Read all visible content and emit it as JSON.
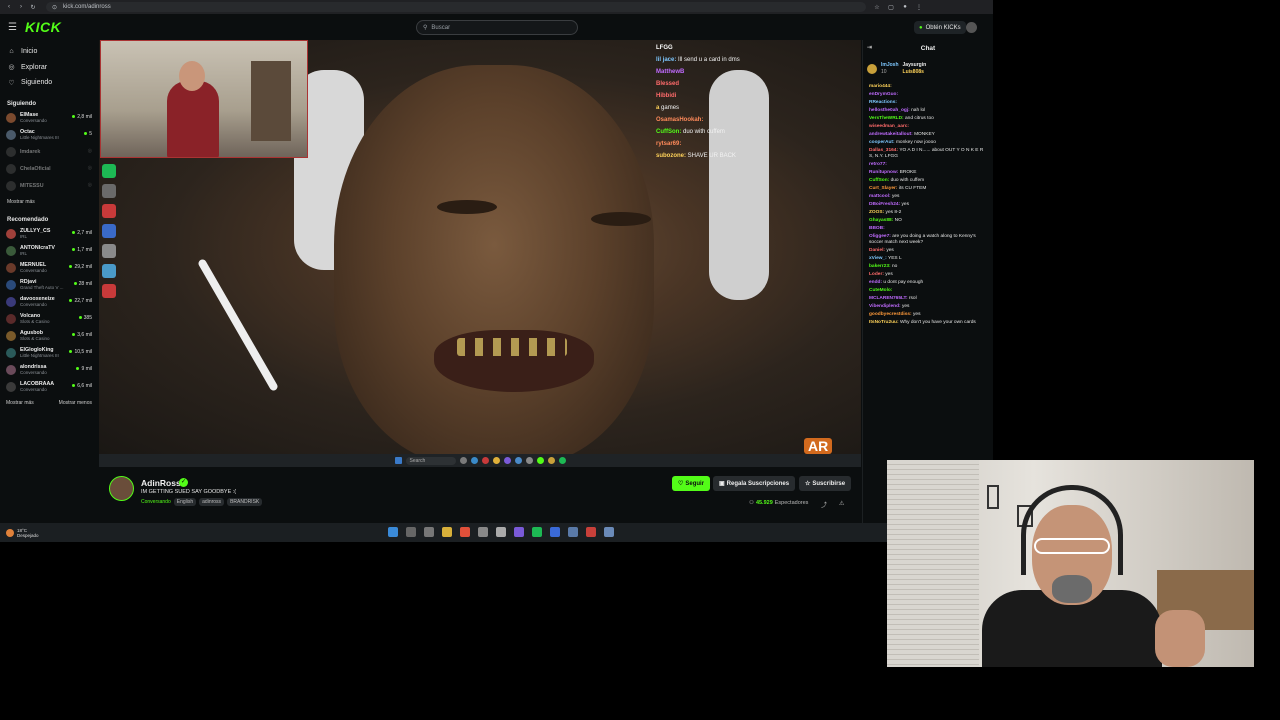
{
  "browser": {
    "url": "kick.com/adinross"
  },
  "header": {
    "logo": "KICK",
    "search_placeholder": "Buscar",
    "obtain_kicks": "Obtén KICKs"
  },
  "sidebar": {
    "nav": [
      {
        "label": "Inicio",
        "icon": "home-icon"
      },
      {
        "label": "Explorar",
        "icon": "compass-icon"
      },
      {
        "label": "Siguiendo",
        "icon": "heart-icon"
      }
    ],
    "following_title": "Siguiendo",
    "following": [
      {
        "name": "ElMase",
        "category": "Conversando",
        "viewers": "2,8 mil",
        "live": true,
        "color": "#7b4a2e"
      },
      {
        "name": "Octac",
        "category": "Little Nightmares III",
        "viewers": "5",
        "live": true,
        "color": "#4a5a6a"
      },
      {
        "name": "Imdarek",
        "category": "",
        "viewers": "",
        "live": false,
        "color": "#555555"
      },
      {
        "name": "ChelaOficial",
        "category": "",
        "viewers": "",
        "live": false,
        "color": "#555555"
      },
      {
        "name": "MITESSU",
        "category": "",
        "viewers": "",
        "live": false,
        "color": "#555555"
      }
    ],
    "following_more": "Mostrar más",
    "recommended_title": "Recomendado",
    "recommended": [
      {
        "name": "ZULLYY_CS",
        "category": "IRL",
        "viewers": "2,7 mil",
        "color": "#a0403a"
      },
      {
        "name": "ANTONIcraTV",
        "category": "IRL",
        "viewers": "1,7 mil",
        "color": "#3a5a3a"
      },
      {
        "name": "MERNUEL",
        "category": "Conversando",
        "viewers": "29,2 mil",
        "color": "#6a3a2a"
      },
      {
        "name": "RDjavi",
        "category": "Grand Theft Auto V ...",
        "viewers": "28 mil",
        "color": "#2a4a7a"
      },
      {
        "name": "davooxeneize",
        "category": "Conversando",
        "viewers": "22,7 mil",
        "color": "#3a3a7a"
      },
      {
        "name": "Volcano",
        "category": "Slots & Casino",
        "viewers": "385",
        "color": "#5a2a2a"
      },
      {
        "name": "Agusbob",
        "category": "Slots & Casino",
        "viewers": "3,6 mil",
        "color": "#7a5a2a"
      },
      {
        "name": "ElGlogloKing",
        "category": "Little Nightmares III",
        "viewers": "10,5 mil",
        "color": "#2a5a5a"
      },
      {
        "name": "alondrissa",
        "category": "Conversando",
        "viewers": "9 mil",
        "color": "#6a4a5a"
      },
      {
        "name": "LACOBRAAA",
        "category": "Conversando",
        "viewers": "6,6 mil",
        "color": "#3a3a3a"
      }
    ],
    "more_left": "Mostrar más",
    "more_right": "Mostrar menos"
  },
  "overlay_chat": [
    {
      "user": "LFGG",
      "text": "",
      "color": "#ffffff"
    },
    {
      "user": "lil jace:",
      "text": "Ill send u a card in dms",
      "color": "#7ec8ff"
    },
    {
      "user": "MatthewB",
      "text": "",
      "color": "#c06bff"
    },
    {
      "user": "Blessed",
      "text": "",
      "color": "#ff6b6b"
    },
    {
      "user": "Hibbidi",
      "text": "",
      "color": "#ff6b6b"
    },
    {
      "user": "a",
      "text": "games",
      "color": "#ffd35a"
    },
    {
      "user": "OsamasHookah:",
      "text": "",
      "color": "#ff8a5a"
    },
    {
      "user": "CuffSon:",
      "text": "duo with cuffem",
      "color": "#53fc18"
    },
    {
      "user": "rytsar69:",
      "text": "",
      "color": "#ff8a5a"
    },
    {
      "user": "subozone:",
      "text": "SHAVE UR BACK",
      "color": "#ffd35a"
    }
  ],
  "stream": {
    "streamer": "AdinRoss",
    "title": "IM GETTING SUED SAY GOODBYE :(",
    "category": "Conversando",
    "tags": [
      "English",
      "adinross",
      "BRANDRISK"
    ],
    "follow": "Seguir",
    "gift": "Regala Suscripciones",
    "subscribe": "Suscribirse",
    "viewers": "45.929",
    "viewers_label": "Espectadores",
    "taskbar_search": "Search",
    "ar_logo": "AR"
  },
  "chat": {
    "title": "Chat",
    "pinned": [
      {
        "user": "ImJosh",
        "amount": "10"
      },
      {
        "user": "Jaysurgin",
        "amount": "5"
      },
      {
        "user": "Luis808s",
        "amount": "2"
      }
    ],
    "messages": [
      {
        "user": "mario444:",
        "text": "",
        "color": "#ffd35a"
      },
      {
        "user": "enDrymGuo:",
        "text": "",
        "color": "#c06bff"
      },
      {
        "user": "RReactions:",
        "text": "",
        "color": "#7ec8ff"
      },
      {
        "user": "hellosthe0ah_ogj:",
        "text": "nah lol",
        "color": "#c06bff"
      },
      {
        "user": "VersTheWRLD:",
        "text": "and citrus too",
        "color": "#53fc18"
      },
      {
        "user": "wiseedman_aarc:",
        "text": "",
        "color": "#ff6b6b"
      },
      {
        "user": "andrewtakeitallout:",
        "text": "MONKEY",
        "color": "#c06bff"
      },
      {
        "user": "cooperAut:",
        "text": "monkey now joooo",
        "color": "#7ec8ff"
      },
      {
        "user": "Dallas_3164:",
        "text": "YO A D I N...... about OUT Y O N K E R S, N.Y. LFGG",
        "color": "#ff6b6b"
      },
      {
        "user": "retro77:",
        "text": "",
        "color": "#c06bff"
      },
      {
        "user": "Runitupnow:",
        "text": "BROKE",
        "color": "#c06bff"
      },
      {
        "user": "CuffSon:",
        "text": "duo with cuffem",
        "color": "#53fc18"
      },
      {
        "user": "Curt_Slayer:",
        "text": "its CU FTEM",
        "color": "#ff9a3a"
      },
      {
        "user": "mattcool:",
        "text": "yes",
        "color": "#c06bff"
      },
      {
        "user": "DBoiFresh24:",
        "text": "yes",
        "color": "#c06bff"
      },
      {
        "user": "ZOOS:",
        "text": "yes 8-2",
        "color": "#ffd35a"
      },
      {
        "user": "Ghayas88:",
        "text": "NO",
        "color": "#53fc18"
      },
      {
        "user": "BBOB:",
        "text": "",
        "color": "#c06bff"
      },
      {
        "user": "Oliggee7:",
        "text": "are you doing a watch along to Kenny's soccer match next week?",
        "color": "#c06bff"
      },
      {
        "user": "Daniel:",
        "text": "yes",
        "color": "#ff6b6b"
      },
      {
        "user": "xView_:",
        "text": "YES L",
        "color": "#7ec8ff"
      },
      {
        "user": "bakerr23:",
        "text": "no",
        "color": "#53fc18"
      },
      {
        "user": "Loder:",
        "text": "yes",
        "color": "#ff6b6b"
      },
      {
        "user": "endd:",
        "text": "u dont pay enough",
        "color": "#c06bff"
      },
      {
        "user": "CuteMolo:",
        "text": "",
        "color": "#53fc18"
      },
      {
        "user": "MCLAREN765LT:",
        "text": "rsol",
        "color": "#c06bff"
      },
      {
        "user": "Vibendiplend:",
        "text": "yes",
        "color": "#c06bff"
      },
      {
        "user": "goodbyecrestdiss:",
        "text": "yes",
        "color": "#ff9a3a"
      },
      {
        "user": "ItsNoTru2uu:",
        "text": "Why don't you have your own cards",
        "color": "#ffd35a"
      }
    ]
  },
  "host_taskbar": {
    "temp": "18°C",
    "weather": "Despejado"
  }
}
